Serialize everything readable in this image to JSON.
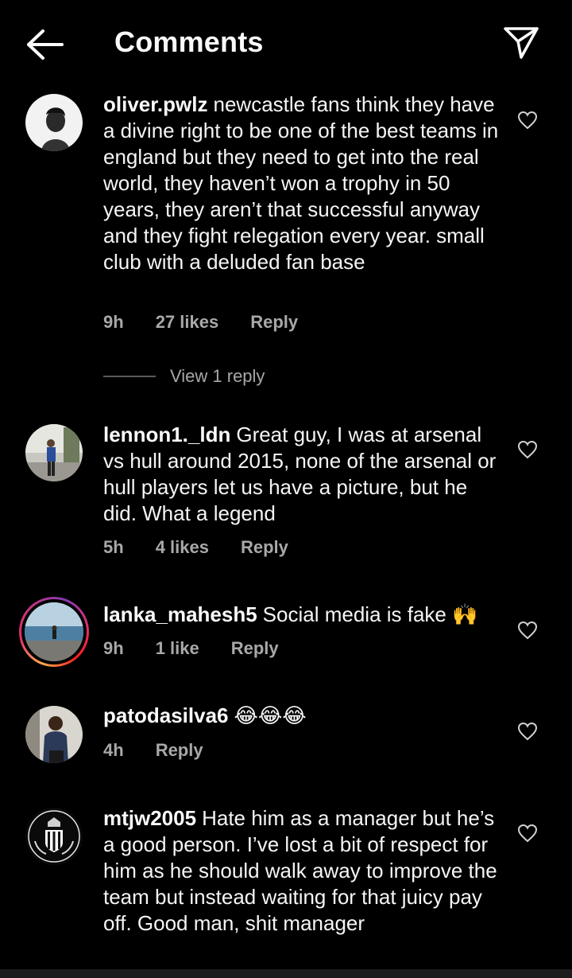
{
  "header": {
    "title": "Comments",
    "back_icon": "arrow-left-icon",
    "send_icon": "paper-plane-icon"
  },
  "colors": {
    "background": "#000000",
    "text": "#f5f5f5",
    "secondary_text": "#a8a8a8",
    "story_ring": "#e1306c"
  },
  "comments": [
    {
      "username": "oliver.pwlz",
      "text": "newcastle fans think they have a divine right to be one of the best teams in england but they need to get into the real world, they haven’t won a trophy in 50 years, they aren’t that successful anyway and they fight relegation every year. small club with a deluded fan base",
      "time": "9h",
      "likes": "27 likes",
      "reply": "Reply",
      "view_replies": "View 1 reply"
    },
    {
      "username": "lennon1._ldn",
      "text": "Great guy, I was at arsenal vs hull around 2015, none of the arsenal or hull players let us have a picture, but he did. What a legend",
      "time": "5h",
      "likes": "4 likes",
      "reply": "Reply"
    },
    {
      "username": "lanka_mahesh5",
      "text": "Social media is fake 🙌",
      "time": "9h",
      "likes": "1 like",
      "reply": "Reply"
    },
    {
      "username": "patodasilva6",
      "text": "😂😂😂",
      "time": "4h",
      "reply": "Reply"
    },
    {
      "username": "mtjw2005",
      "text": "Hate him as a manager but he’s a good person. I’ve lost a bit of respect for him as he should walk away to improve the team but instead waiting for that juicy pay off. Good man, shit manager"
    }
  ]
}
